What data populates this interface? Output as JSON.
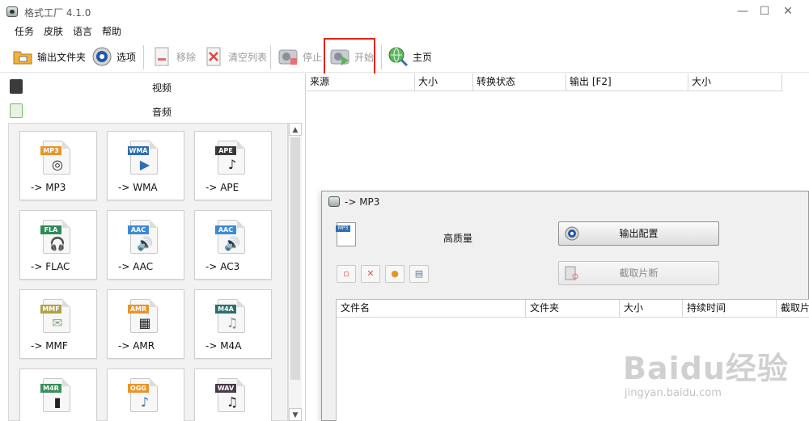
{
  "window": {
    "title": "格式工厂 4.1.0",
    "controls": [
      "—",
      "☐",
      "✕"
    ]
  },
  "menu": [
    "任务",
    "皮肤",
    "语言",
    "帮助"
  ],
  "toolbar": {
    "output_folder": "输出文件夹",
    "options": "选项",
    "remove": "移除",
    "clear_list": "清空列表",
    "stop": "停止",
    "start": "开始",
    "home": "主页"
  },
  "categories": {
    "video": "视频",
    "audio": "音频"
  },
  "formats": [
    {
      "tag": "MP3",
      "label": "-> MP3",
      "color": "#e8942a",
      "glyph": "◎"
    },
    {
      "tag": "WMA",
      "label": "-> WMA",
      "color": "#2f6fb1",
      "glyph": "▶"
    },
    {
      "tag": "APE",
      "label": "-> APE",
      "color": "#3a3a3a",
      "glyph": "♪"
    },
    {
      "tag": "FLA",
      "label": "-> FLAC",
      "color": "#2e8b57",
      "glyph": "🎧"
    },
    {
      "tag": "AAC",
      "label": "-> AAC",
      "color": "#3b8bd6",
      "glyph": "🔊"
    },
    {
      "tag": "AAC",
      "label": "-> AC3",
      "color": "#3b8bd6",
      "glyph": "🔊"
    },
    {
      "tag": "MMF",
      "label": "-> MMF",
      "color": "#b0a04a",
      "glyph": "✉"
    },
    {
      "tag": "AMR",
      "label": "-> AMR",
      "color": "#e8942a",
      "glyph": "▦"
    },
    {
      "tag": "M4A",
      "label": "-> M4A",
      "color": "#2e6e6e",
      "glyph": "♫"
    },
    {
      "tag": "M4R",
      "label": "",
      "color": "#3a8f5a",
      "glyph": "▮"
    },
    {
      "tag": "OGG",
      "label": "",
      "color": "#e8942a",
      "glyph": "♪"
    },
    {
      "tag": "WAV",
      "label": "",
      "color": "#4a3a4a",
      "glyph": "♫"
    }
  ],
  "task_table": {
    "columns": [
      "来源",
      "大小",
      "转换状态",
      "输出 [F2]",
      "大小"
    ]
  },
  "dialog": {
    "title": "-> MP3",
    "quality": "高质量",
    "output_config": "输出配置",
    "clip": "截取片断",
    "columns": [
      "文件名",
      "文件夹",
      "大小",
      "持续时间",
      "截取片"
    ]
  },
  "watermark": {
    "logo": "Baidu经验",
    "url": "jingyan.baidu.com"
  },
  "colors": {
    "highlight_box": "#e0251b",
    "link_blue": "#2f6fb1"
  }
}
